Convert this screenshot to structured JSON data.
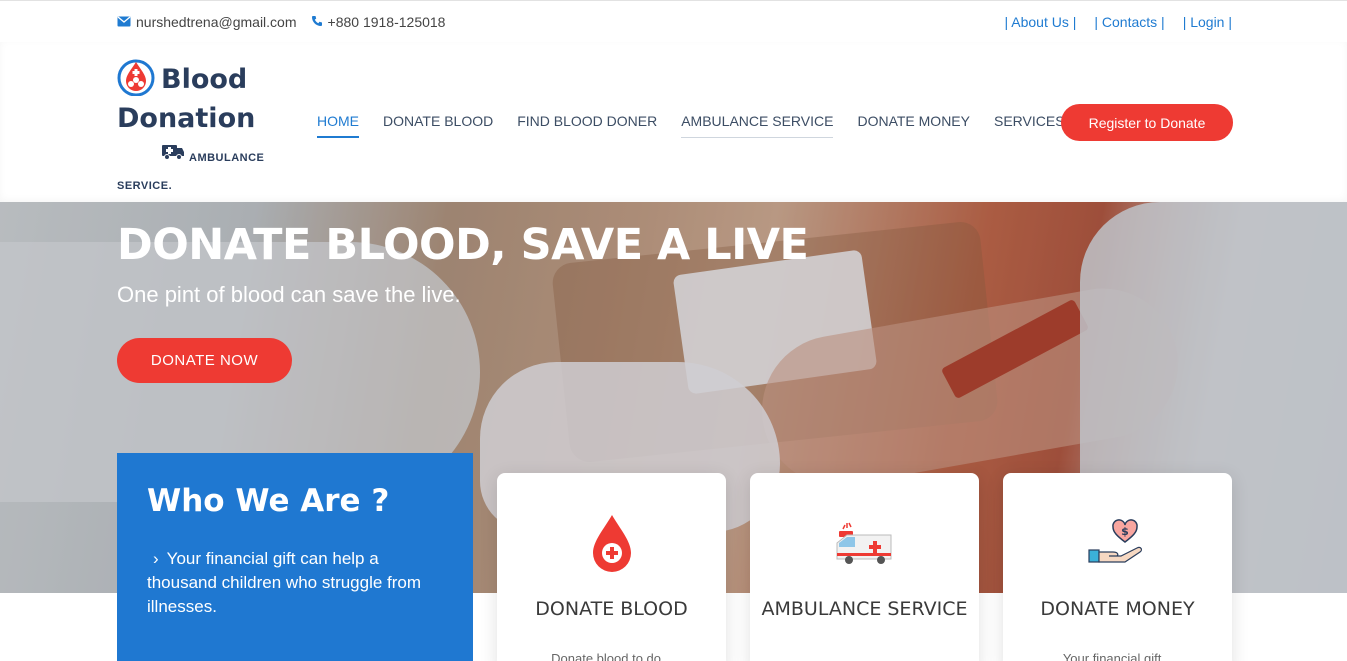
{
  "topbar": {
    "email": "nurshedtrena@gmail.com",
    "phone": "+880 1918-125018",
    "links": [
      "| About Us |",
      "| Contacts |",
      "| Login |"
    ]
  },
  "logo": {
    "line1": "Blood",
    "line2": "Donation",
    "line3": "AMBULANCE",
    "line4": "SERVICE."
  },
  "nav": {
    "items": [
      "HOME",
      "DONATE BLOOD",
      "FIND BLOOD DONER",
      "AMBULANCE SERVICE",
      "DONATE MONEY",
      "SERVICES"
    ],
    "register": "Register to Donate"
  },
  "hero": {
    "title": "DONATE BLOOD, SAVE A LIVE",
    "subtitle": "One pint of blood can save the live.",
    "cta": "DONATE NOW"
  },
  "who": {
    "title": "Who We Are ?",
    "text": "Your financial gift can help a thousand children who struggle from illnesses."
  },
  "cards": [
    {
      "title": "DONATE BLOOD",
      "text": "Donate blood to do..."
    },
    {
      "title": "AMBULANCE SERVICE",
      "text": ""
    },
    {
      "title": "DONATE MONEY",
      "text": "Your financial gift..."
    }
  ],
  "colors": {
    "accent": "#ee3a33",
    "primary": "#1f78d1",
    "brand": "#2a3d5c"
  }
}
